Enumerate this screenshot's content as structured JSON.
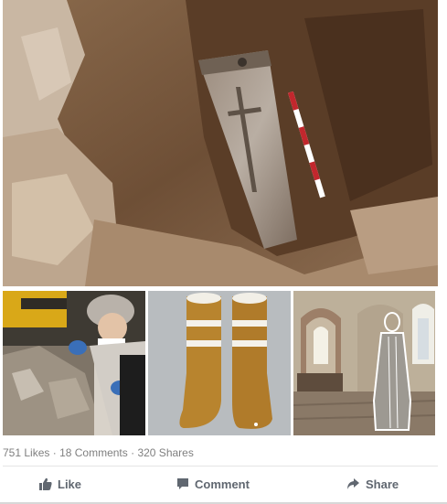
{
  "post": {
    "stats": {
      "likes": "751 Likes",
      "sep1": "·",
      "comments": "18 Comments",
      "sep2": "·",
      "shares": "320 Shares"
    },
    "actions": {
      "like_label": "Like",
      "comment_label": "Comment",
      "share_label": "Share"
    },
    "images": [
      {
        "name": "excavated-coffin-photo"
      },
      {
        "name": "archaeologist-examining-remains-photo"
      },
      {
        "name": "reconstructed-boots-photo"
      },
      {
        "name": "church-interior-reconstruction-photo"
      }
    ]
  },
  "colors": {
    "action_text": "#606770",
    "stats_text": "#7f7f7f",
    "divider": "#e5e5e5"
  },
  "icons": {
    "like": "thumbs-up-icon",
    "comment": "comment-icon",
    "share": "share-arrow-icon"
  }
}
